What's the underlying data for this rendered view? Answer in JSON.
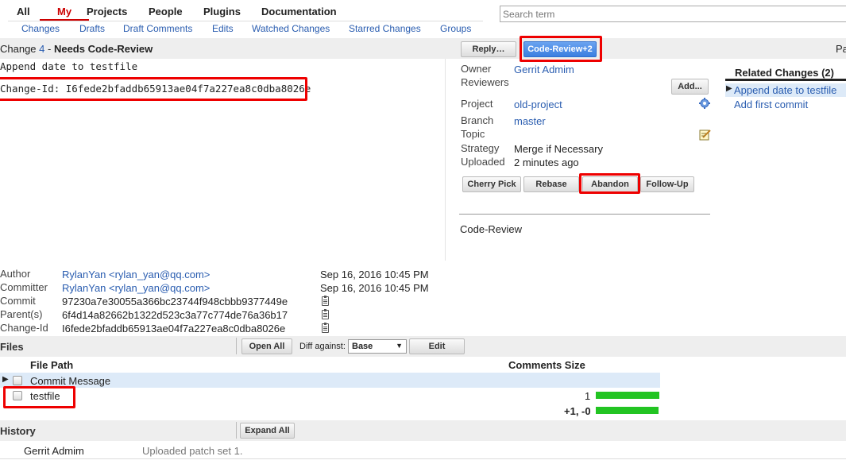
{
  "nav": {
    "top": [
      "All",
      "My",
      "Projects",
      "People",
      "Plugins",
      "Documentation"
    ],
    "sub": [
      "Changes",
      "Drafts",
      "Draft Comments",
      "Edits",
      "Watched Changes",
      "Starred Changes",
      "Groups"
    ]
  },
  "search": {
    "placeholder": "Search term"
  },
  "change": {
    "prefix": "Change ",
    "number": "4",
    "sep": " - ",
    "status": "Needs Code-Review",
    "message_line1": "Append date to testfile",
    "change_id_line": "Change-Id: I6fede2bfaddb65913ae04f7a227ea8c0dba8026e"
  },
  "actions": {
    "reply": "Reply…",
    "code_review": "Code-Review+2",
    "add": "Add...",
    "cherry_pick": "Cherry Pick",
    "rebase": "Rebase",
    "abandon": "Abandon",
    "follow_up": "Follow-Up",
    "pa": "Pa"
  },
  "info": {
    "owner_label": "Owner",
    "owner": "Gerrit Admim",
    "reviewers_label": "Reviewers",
    "project_label": "Project",
    "project": "old-project",
    "branch_label": "Branch",
    "branch": "master",
    "topic_label": "Topic",
    "strategy_label": "Strategy",
    "strategy": "Merge if Necessary",
    "uploaded_label": "Uploaded",
    "uploaded": "2 minutes ago",
    "label_name": "Code-Review"
  },
  "related": {
    "title": "Related Changes (2)",
    "items": [
      "Append date to testfile",
      "Add first commit"
    ]
  },
  "commit": {
    "author_label": "Author",
    "author": "RylanYan <rylan_yan@qq.com>",
    "author_date": "Sep 16, 2016 10:45 PM",
    "committer_label": "Committer",
    "committer": "RylanYan <rylan_yan@qq.com>",
    "committer_date": "Sep 16, 2016 10:45 PM",
    "commit_label": "Commit",
    "commit": "97230a7e30055a366bc23744f948cbbb9377449e",
    "parents_label": "Parent(s)",
    "parents": "6f4d14a82662b1322d523c3a77c774de76a36b17",
    "changeid_label": "Change-Id",
    "changeid": "I6fede2bfaddb65913ae04f7a227ea8c0dba8026e"
  },
  "files": {
    "title": "Files",
    "open_all": "Open All",
    "diff_against_label": "Diff against:",
    "diff_against_value": "Base",
    "edit": "Edit",
    "col_path": "File Path",
    "col_comments_size": "Comments Size",
    "rows": [
      {
        "name": "Commit Message",
        "count": ""
      },
      {
        "name": "testfile",
        "count": "1"
      }
    ],
    "total": "+1, -0"
  },
  "history": {
    "title": "History",
    "expand_all": "Expand All",
    "entry_author": "Gerrit Admim",
    "entry_text": "Uploaded patch set 1."
  },
  "colors": {
    "link": "#2a5db0",
    "highlight_box": "#e00000",
    "accent_button": "#3b7fe0",
    "size_bar": "#22c422"
  }
}
